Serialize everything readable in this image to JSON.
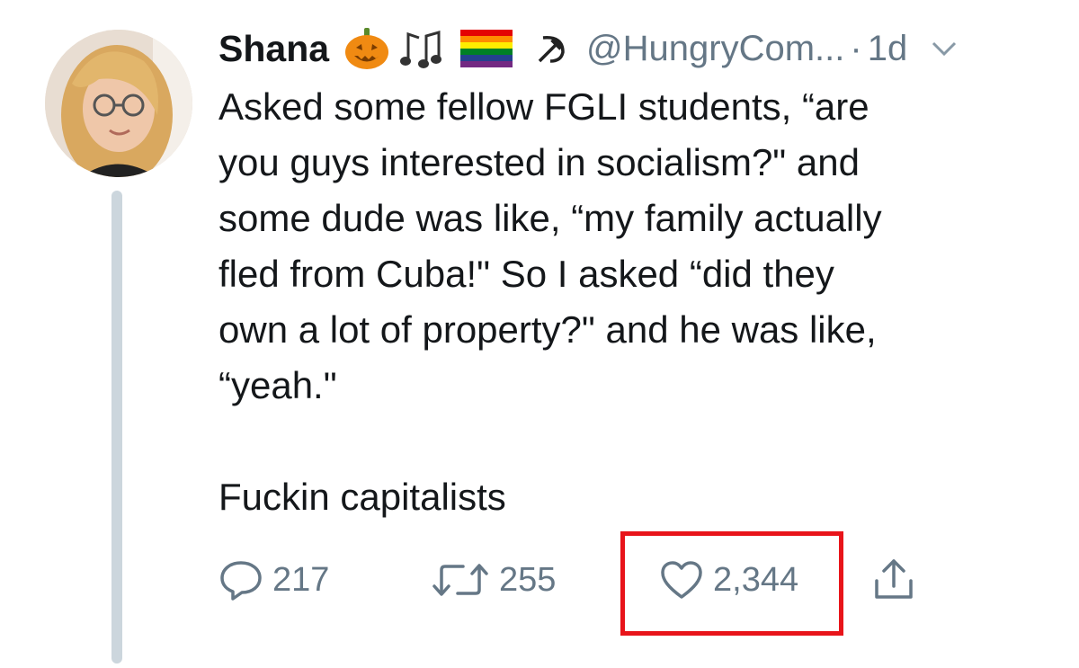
{
  "tweet": {
    "author_name": "Shana",
    "badges": [
      "jack-o-lantern-icon",
      "musical-notes-icon",
      "rainbow-flag-icon",
      "hammer-and-sickle-icon"
    ],
    "handle": "@HungryCom...",
    "separator": "·",
    "time": "1d",
    "body": "Asked some fellow FGLI students, “are\nyou guys interested in socialism?\" and\nsome dude was like, “my family actually\nfled from Cuba!\" So I asked “did they\nown a lot of property?\" and he was like,\n“yeah.\"",
    "body_tail": "Fuckin capitalists",
    "replies": "217",
    "retweets": "255",
    "likes": "2,344"
  },
  "colors": {
    "text": "#14171a",
    "muted": "#657786",
    "thread_line": "#ccd6dd",
    "highlight": "#e8141a"
  }
}
